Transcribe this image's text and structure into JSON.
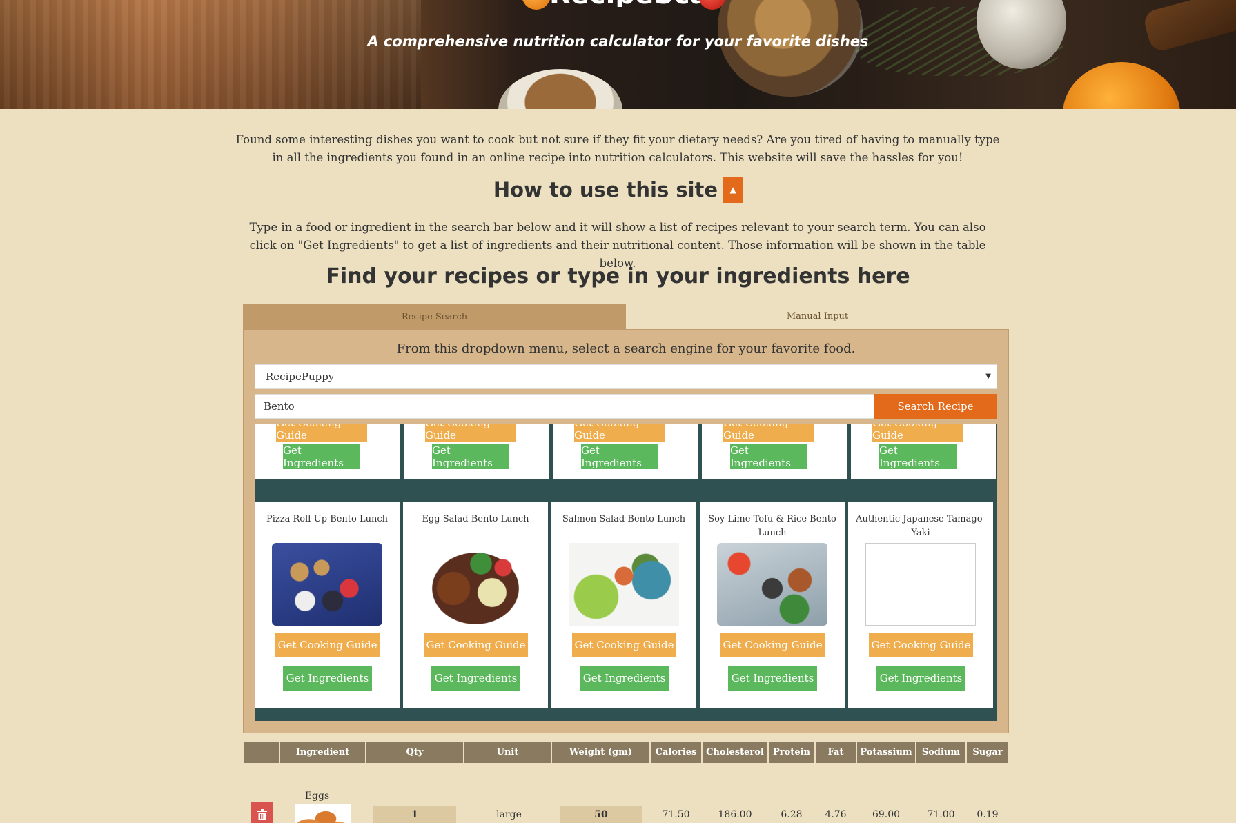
{
  "header": {
    "logo_text": "RecipeScan",
    "tagline": "A comprehensive nutrition calculator for your favorite dishes"
  },
  "intro_text": "Found some interesting dishes you want to cook but not sure if they fit your dietary needs? Are you tired of having to manually type in all the ingredients you found in an online recipe into nutrition calculators. This website will save the hassles for you!",
  "howto": {
    "title": "How to use this site",
    "text": "Type in a food or ingredient in the search bar below and it will show a list of recipes relevant to your search term. You can also click on \"Get Ingredients\" to get a list of ingredients and their nutritional content. Those information will be shown in the table below."
  },
  "find_title": "Find your recipes or type in your ingredients here",
  "tabs": [
    {
      "label": "Recipe Search",
      "active": true
    },
    {
      "label": "Manual Input",
      "active": false
    }
  ],
  "panel": {
    "instruction": "From this dropdown menu, select a search engine for your favorite food.",
    "engine_selected": "RecipePuppy",
    "search_value": "Bento",
    "search_button": "Search Recipe"
  },
  "buttons": {
    "guide": "Get Cooking Guide",
    "ingredients": "Get Ingredients"
  },
  "recipes": [
    {
      "title": "Pizza Roll-Up Bento Lunch",
      "image": "pizza-bento-image"
    },
    {
      "title": "Egg Salad Bento Lunch",
      "image": "egg-salad-bento-image"
    },
    {
      "title": "Salmon Salad Bento Lunch",
      "image": "salmon-salad-bento-image"
    },
    {
      "title": "Soy-Lime Tofu & Rice Bento Lunch",
      "image": "tofu-rice-bento-image"
    },
    {
      "title": "Authentic Japanese Tamago-Yaki",
      "image": "missing-image"
    }
  ],
  "table": {
    "headers": [
      "",
      "Ingredient",
      "Qty",
      "Unit",
      "Weight (gm)",
      "Calories",
      "Cholesterol",
      "Protein",
      "Fat",
      "Potassium",
      "Sodium",
      "Sugar"
    ],
    "rows": [
      {
        "ingredient": "Eggs",
        "qty": "1",
        "unit": "large",
        "weight": "50",
        "calories": "71.50",
        "cholesterol": "186.00",
        "protein": "6.28",
        "fat": "4.76",
        "potassium": "69.00",
        "sodium": "71.00",
        "sugar": "0.19"
      }
    ]
  },
  "colors": {
    "accent": "#e36a1a",
    "guide_button": "#f0ad4e",
    "ingredients_button": "#5cb85c",
    "delete_button": "#d9534f",
    "results_bg": "#2f5152",
    "page_bg": "#ece0c0"
  }
}
